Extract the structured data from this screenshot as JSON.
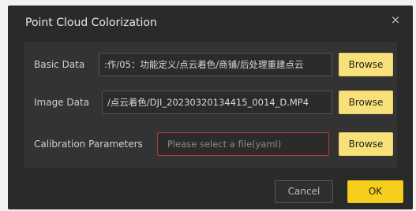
{
  "dialog": {
    "title": "Point Cloud Colorization",
    "close_icon": "×"
  },
  "basic_data": {
    "label": "Basic Data",
    "value": ":作/05：功能定义/点云着色/商铺/后处理重建点云",
    "browse_label": "Browse"
  },
  "image_data": {
    "label": "Image Data",
    "value": "/点云着色/DJI_20230320134415_0014_D.MP4",
    "browse_label": "Browse"
  },
  "calibration": {
    "label": "Calibration Parameters",
    "placeholder": "Please select a file(yaml)",
    "browse_label": "Browse"
  },
  "footer": {
    "cancel_label": "Cancel",
    "ok_label": "OK"
  },
  "colors": {
    "accent": "#f5cf1a",
    "browse": "#f8e07a",
    "error_border": "#b23a3a",
    "dialog_bg": "#2a2a2a"
  }
}
